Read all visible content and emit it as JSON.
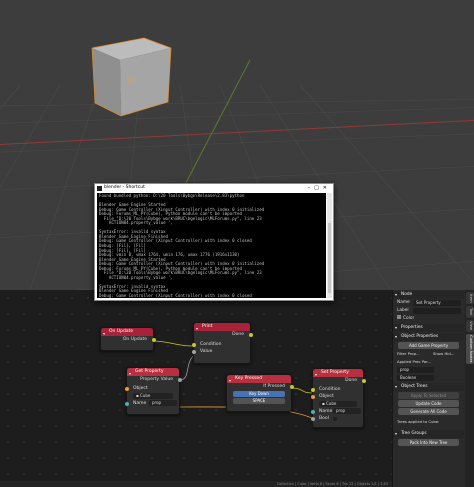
{
  "terminal": {
    "title": "blender - Shortcut",
    "lines": [
      "Found bundled python: D:\\20 Tools\\Bybge\\Release\\2.83\\python",
      "",
      "Blender Game Engine Started",
      "Debug: Game Controller (Xinput Controller) with index 0 initialized",
      "Debug: Forums_ML_PY(Cube), Python module can't be imported",
      "  File \"D:\\20 Tools\\Bybge work\\BRUC\\bgelogic\\MLForums.py\", line 23",
      "    ACTION04.property_value ',",
      "",
      "SyntaxError: invalid syntax",
      "Blender Game Engine Finished",
      "Debug: Game Controller (Xinput Controller) with index 0 closed",
      "Debug: [Fil], [Fil]",
      "Debug: [Fil], [Fil]",
      "Debug: vmin 0, vmax 1764, umin 176, umax 1776 (1916x1130)",
      "Blender Game Engine Started",
      "Debug: Game Controller (Xinput Controller) with index 0 initialized",
      "Debug: Forums_ML_PY(Cube), Python module can't be imported",
      "  File \"D:\\20 Tools\\Bybge work\\BRUC\\bgelogic\\MLForums.py\", line 23",
      "    ACTION04.property_value ',",
      "",
      "SyntaxError: invalid syntax",
      "Blender Game Engine Finished",
      "Debug: Game Controller (Xinput Controller) with index 0 closed"
    ]
  },
  "nodes": {
    "on_update": {
      "title": "On Update",
      "out": "On Update"
    },
    "print": {
      "title": "Print",
      "out": "Done",
      "in1": "Condition",
      "in2": "Value"
    },
    "get_property": {
      "title": "Get Property",
      "out": "Property Value",
      "object_label": "Object",
      "object_value": "Cube",
      "name_label": "Name",
      "name_value": "prop"
    },
    "key_pressed": {
      "title": "Key Pressed",
      "out": "If Pressed",
      "mode": "Key Down",
      "key": "SPACE"
    },
    "set_property": {
      "title": "Set Property",
      "out": "Done",
      "in1": "Condition",
      "obj_label": "Object",
      "obj_value": "Cube",
      "name_label": "Name",
      "name_value": "prop",
      "bool_label": "Bool"
    }
  },
  "sidebar": {
    "tabs": [
      "Item",
      "Tool",
      "View",
      "Custom Nodes"
    ],
    "node_panel": "Node",
    "name_label": "Name",
    "name_value": "Set Property",
    "label_label": "Label",
    "color_label": "Color",
    "properties_panel": "Properties",
    "object_properties_panel": "Object Properties",
    "add_game_property": "Add Game Property",
    "filter_label": "Filter Prop...",
    "show_hidden": "Show Hid...",
    "applied_label": "Applied Prec Par...",
    "prop_field": "prop",
    "boolean_label": "Boolean",
    "object_trees_panel": "Object Trees",
    "apply_to_selected": "Apply To Selected",
    "update_code": "Update Code",
    "generate_all_code": "Generate All Code",
    "trees_applied": "Trees applied to Cube:",
    "tree_groups_panel": "Tree Groups",
    "pack_into_new_tree": "Pack Into New Tree"
  },
  "status": {
    "text": "Collection | Cube | Verts 8 | Faces 6 | Tris 12 | Objects 1/1 | 2.83"
  }
}
